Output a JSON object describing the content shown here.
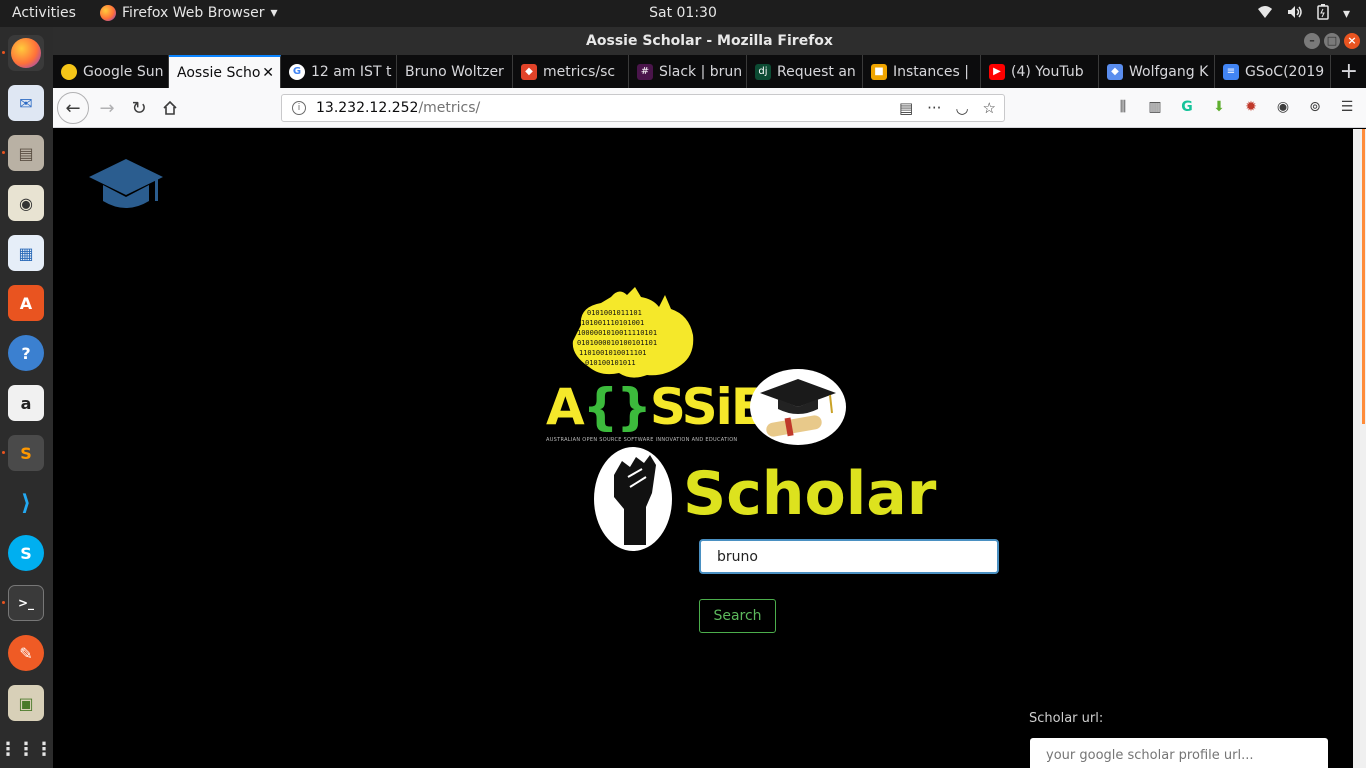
{
  "topbar": {
    "activities": "Activities",
    "app_name": "Firefox Web Browser",
    "clock": "Sat 01:30"
  },
  "window": {
    "title": "Aossie Scholar - Mozilla Firefox"
  },
  "tabs": [
    {
      "label": "Google Sun",
      "icon": "sun-icon",
      "color": "#f5c518"
    },
    {
      "label": "Aossie Scho",
      "icon": "none",
      "color": "#f9f9fa",
      "active": true
    },
    {
      "label": "12 am IST t",
      "icon": "google-icon",
      "color": "#4285f4"
    },
    {
      "label": "Bruno Woltzer",
      "icon": "none",
      "color": "#0c0c0d"
    },
    {
      "label": "metrics/sc",
      "icon": "gitlab-icon",
      "color": "#e24329"
    },
    {
      "label": "Slack | brun",
      "icon": "slack-icon",
      "color": "#4a154b"
    },
    {
      "label": "Request an",
      "icon": "django-icon",
      "color": "#0c4b33"
    },
    {
      "label": "Instances |",
      "icon": "aws-box-icon",
      "color": "#f0a500"
    },
    {
      "label": "(4) YouTub",
      "icon": "youtube-icon",
      "color": "#ff0000"
    },
    {
      "label": "Wolfgang K",
      "icon": "diamond-icon",
      "color": "#5a8dee"
    },
    {
      "label": "GSoC(2019",
      "icon": "docs-icon",
      "color": "#4285f4"
    }
  ],
  "urlbar": {
    "host": "13.232.12.252",
    "path": "/metrics/"
  },
  "page": {
    "aossie_word_a": "A",
    "aossie_word_brace": "{}",
    "aossie_word_rest": "SSiE",
    "aossie_tagline": "AUSTRALIAN OPEN SOURCE SOFTWARE INNOVATION AND EDUCATION",
    "scholar_word": "Scholar",
    "search_value": "bruno",
    "search_button": "Search",
    "scholar_url_label": "Scholar url:",
    "scholar_url_placeholder": "your google scholar profile url..."
  },
  "colors": {
    "accent_blue": "#0a84ff",
    "search_green": "#5cb85c",
    "aossie_yellow": "#f5e82a",
    "scholar_yellow": "#dde21e",
    "dock_orange": "#e95420"
  }
}
